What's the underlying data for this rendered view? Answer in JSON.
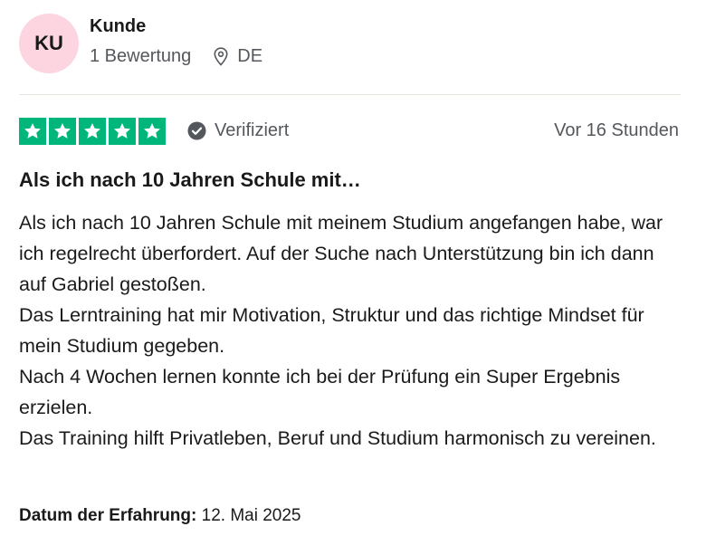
{
  "reviewer": {
    "initials": "KU",
    "name": "Kunde",
    "review_count": "1 Bewertung",
    "country": "DE"
  },
  "review": {
    "rating": 5,
    "max_rating": 5,
    "verified_label": "Verifiziert",
    "date_label": "Vor 16 Stunden",
    "title": "Als ich nach 10 Jahren Schule mit…",
    "body": [
      "Als ich nach 10 Jahren Schule mit meinem Studium angefangen habe, war ich regelrecht überfordert. Auf der Suche nach Unterstützung bin ich dann auf Gabriel gestoßen.",
      "Das Lerntraining hat mir Motivation, Struktur und das richtige Mindset für mein Studium gegeben.",
      "Nach 4 Wochen lernen konnte ich bei der Prüfung ein Super Ergebnis erzielen.",
      "Das Training hilft Privatleben, Beruf und Studium harmonisch zu vereinen."
    ],
    "experience_label": "Datum der Erfahrung:",
    "experience_date": "12. Mai 2025"
  },
  "colors": {
    "star_green": "#00b67a",
    "avatar_pink": "#fcd5e1",
    "meta_gray": "#54575c"
  },
  "icons": [
    "location-pin-icon",
    "star-icon",
    "verified-check-icon"
  ]
}
